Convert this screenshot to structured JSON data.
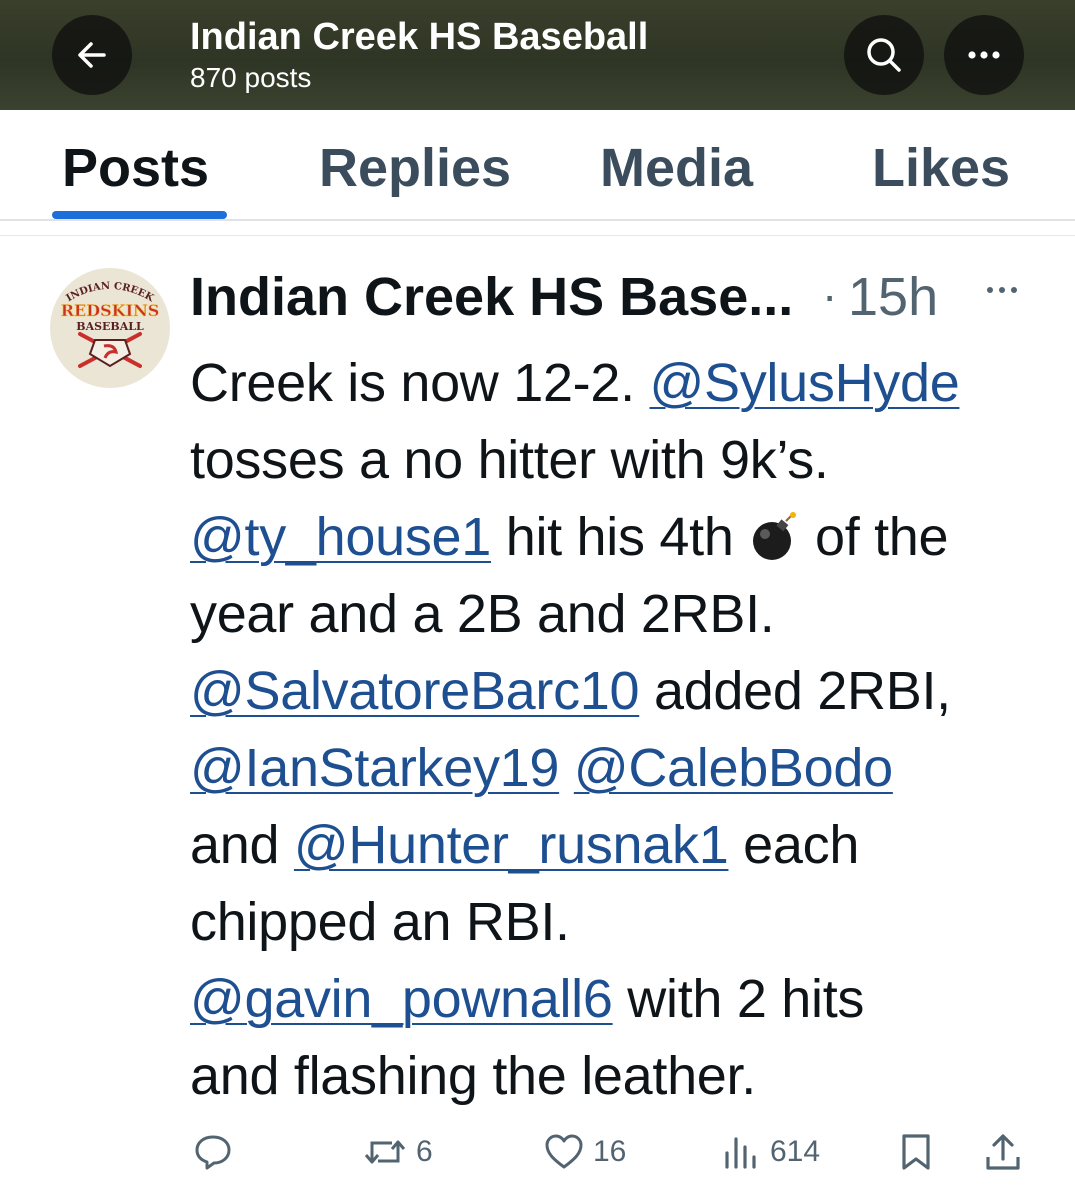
{
  "header": {
    "title": "Indian Creek HS Baseball",
    "post_count": "870 posts"
  },
  "tabs": [
    "Posts",
    "Replies",
    "Media",
    "Likes"
  ],
  "active_tab": "Posts",
  "post": {
    "author": "Indian Creek HS Base...",
    "separator": "·",
    "time": "15h",
    "avatar_text": [
      "INDIAN CREEK",
      "REDSKINS",
      "BASEBALL"
    ],
    "text": {
      "l1a": "Creek is now 12-2.  ",
      "l1m": "@SylusHyde",
      "l2": "tosses a no hitter with 9k’s.",
      "l3m": "@ty_house1",
      "l3a": " hit his 4th ",
      "l3b": " of the",
      "l4": "year and a 2B and 2RBI.",
      "l5m": "@SalvatoreBarc10",
      "l5a": " added 2RBI,",
      "l6m1": "@IanStarkey19",
      "l6m2": "@CalebBodo",
      "l7a": "and ",
      "l7m": "@Hunter_rusnak1",
      "l7b": " each",
      "l8": "chipped an RBI.",
      "l9m": "@gavin_pownall6",
      "l9a": " with 2 hits",
      "l10": "and flashing the leather."
    },
    "emoji": "bomb-icon",
    "actions": {
      "reposts": "6",
      "likes": "16",
      "views": "614"
    }
  },
  "colors": {
    "mention": "#1d4f91",
    "tab_indicator": "#1d6ddb",
    "muted": "#536471"
  }
}
